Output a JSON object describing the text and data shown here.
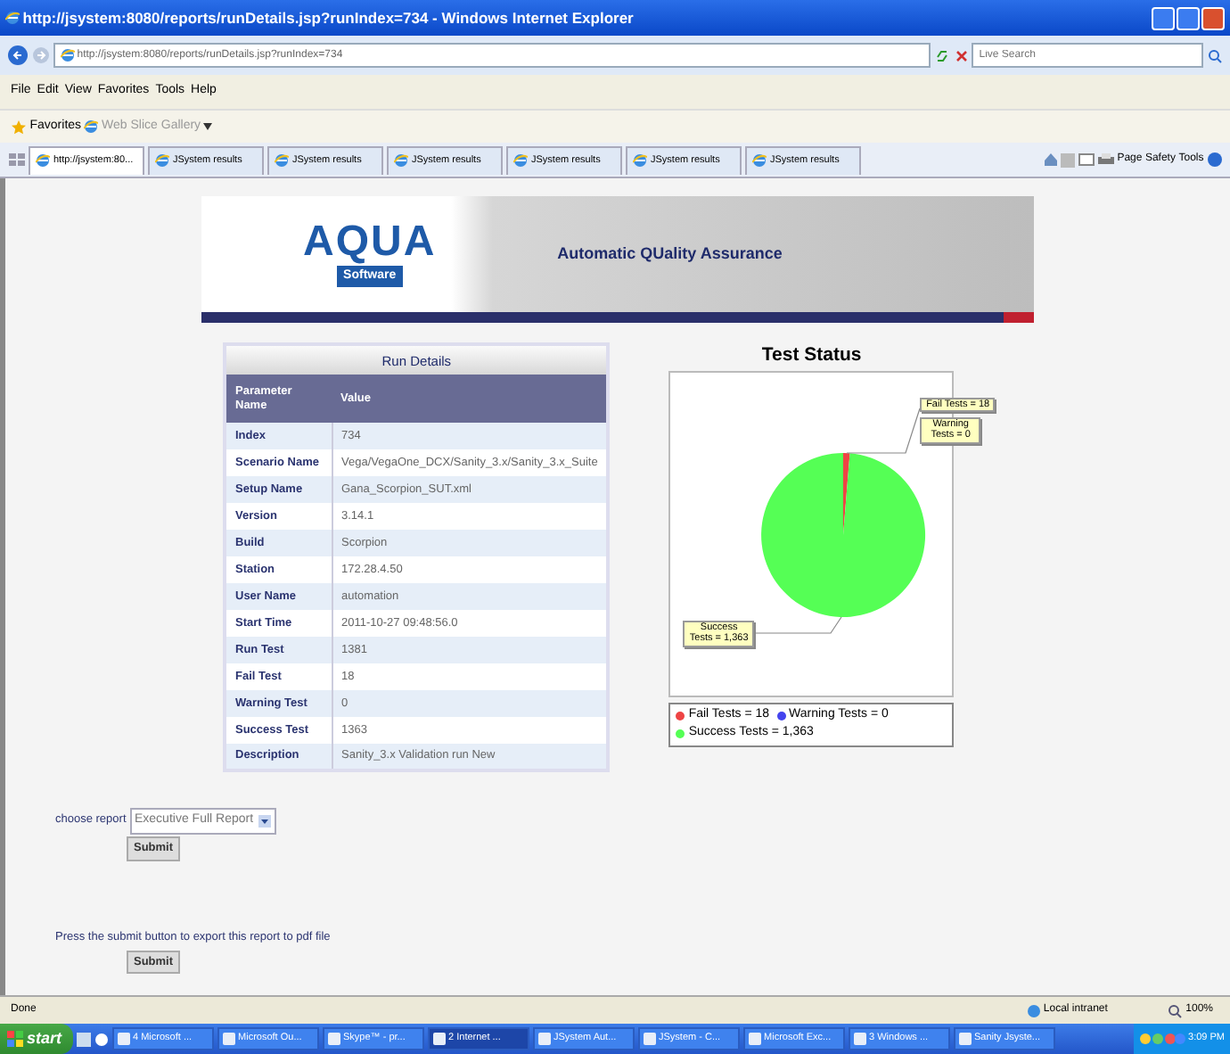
{
  "window": {
    "title": "http://jsystem:8080/reports/runDetails.jsp?runIndex=734 - Windows Internet Explorer"
  },
  "address_bar": {
    "url": "http://jsystem:8080/reports/runDetails.jsp?runIndex=734",
    "search_placeholder": "Live Search"
  },
  "menu": [
    "File",
    "Edit",
    "View",
    "Favorites",
    "Tools",
    "Help"
  ],
  "favorites_bar": {
    "label": "Favorites",
    "items": [
      "Web Slice Gallery"
    ]
  },
  "tabs": [
    {
      "label": "http://jsystem:80...",
      "selected": true
    },
    {
      "label": "JSystem results",
      "selected": false
    },
    {
      "label": "JSystem results",
      "selected": false
    },
    {
      "label": "JSystem results",
      "selected": false
    },
    {
      "label": "JSystem results",
      "selected": false
    },
    {
      "label": "JSystem results",
      "selected": false
    },
    {
      "label": "JSystem results",
      "selected": false
    }
  ],
  "command_bar": [
    "Page",
    "Safety",
    "Tools"
  ],
  "banner": {
    "logo": "AQUA",
    "logo_subtitle": "Software",
    "tagline": "Automatic QUality Assurance"
  },
  "run_details": {
    "title": "Run Details",
    "columns": [
      "Parameter Name",
      "Value"
    ],
    "rows": [
      {
        "name": "Index",
        "value": "734"
      },
      {
        "name": "Scenario Name",
        "value": "Vega/VegaOne_DCX/Sanity_3.x/Sanity_3.x_Suite"
      },
      {
        "name": "Setup Name",
        "value": "Gana_Scorpion_SUT.xml"
      },
      {
        "name": "Version",
        "value": "3.14.1"
      },
      {
        "name": "Build",
        "value": "Scorpion"
      },
      {
        "name": "Station",
        "value": "172.28.4.50"
      },
      {
        "name": "User Name",
        "value": "automation"
      },
      {
        "name": "Start Time",
        "value": "2011-10-27 09:48:56.0"
      },
      {
        "name": "Run Test",
        "value": "1381"
      },
      {
        "name": "Fail Test",
        "value": "18"
      },
      {
        "name": "Warning Test",
        "value": "0"
      },
      {
        "name": "Success Test",
        "value": "1363"
      },
      {
        "name": "Description",
        "value": "Sanity_3.x Validation run New"
      }
    ]
  },
  "test_status": {
    "title": "Test Status",
    "chart_data": {
      "type": "pie",
      "categories": [
        "Fail Tests",
        "Warning Tests",
        "Success Tests"
      ],
      "values": [
        1.3,
        0,
        98.7
      ]
    },
    "callouts": [
      "= 18",
      "= 0",
      "= 1,363"
    ],
    "legend": [
      {
        "label": "= 18",
        "color": "#ee4444"
      },
      {
        "label": "= 0",
        "color": "#4444ee"
      },
      {
        "label": "= 1,363",
        "color": "#55ff55"
      }
    ]
  },
  "report_form": {
    "label": "choose report",
    "value": "Executive Full Report",
    "button": "Submit"
  },
  "export_form": {
    "text": "Press the submit button to export this report to pdf file",
    "button": "Submit"
  },
  "status_bar": {
    "text": "Done",
    "zone": "Local intranet",
    "zoom": "100%"
  },
  "taskbar": {
    "start": "start",
    "items": [
      {
        "label": "4 Microsoft ...",
        "selected": false
      },
      {
        "label": "Microsoft Ou...",
        "selected": false
      },
      {
        "label": "Skype™ - pr...",
        "selected": false
      },
      {
        "label": "2 Internet ...",
        "selected": true
      },
      {
        "label": "JSystem Aut...",
        "selected": false
      },
      {
        "label": "JSystem - C...",
        "selected": false
      },
      {
        "label": "Microsoft Exc...",
        "selected": false
      },
      {
        "label": "3 Windows ...",
        "selected": false
      },
      {
        "label": "Sanity Jsyste...",
        "selected": false
      }
    ],
    "clock": "3:09 PM"
  }
}
